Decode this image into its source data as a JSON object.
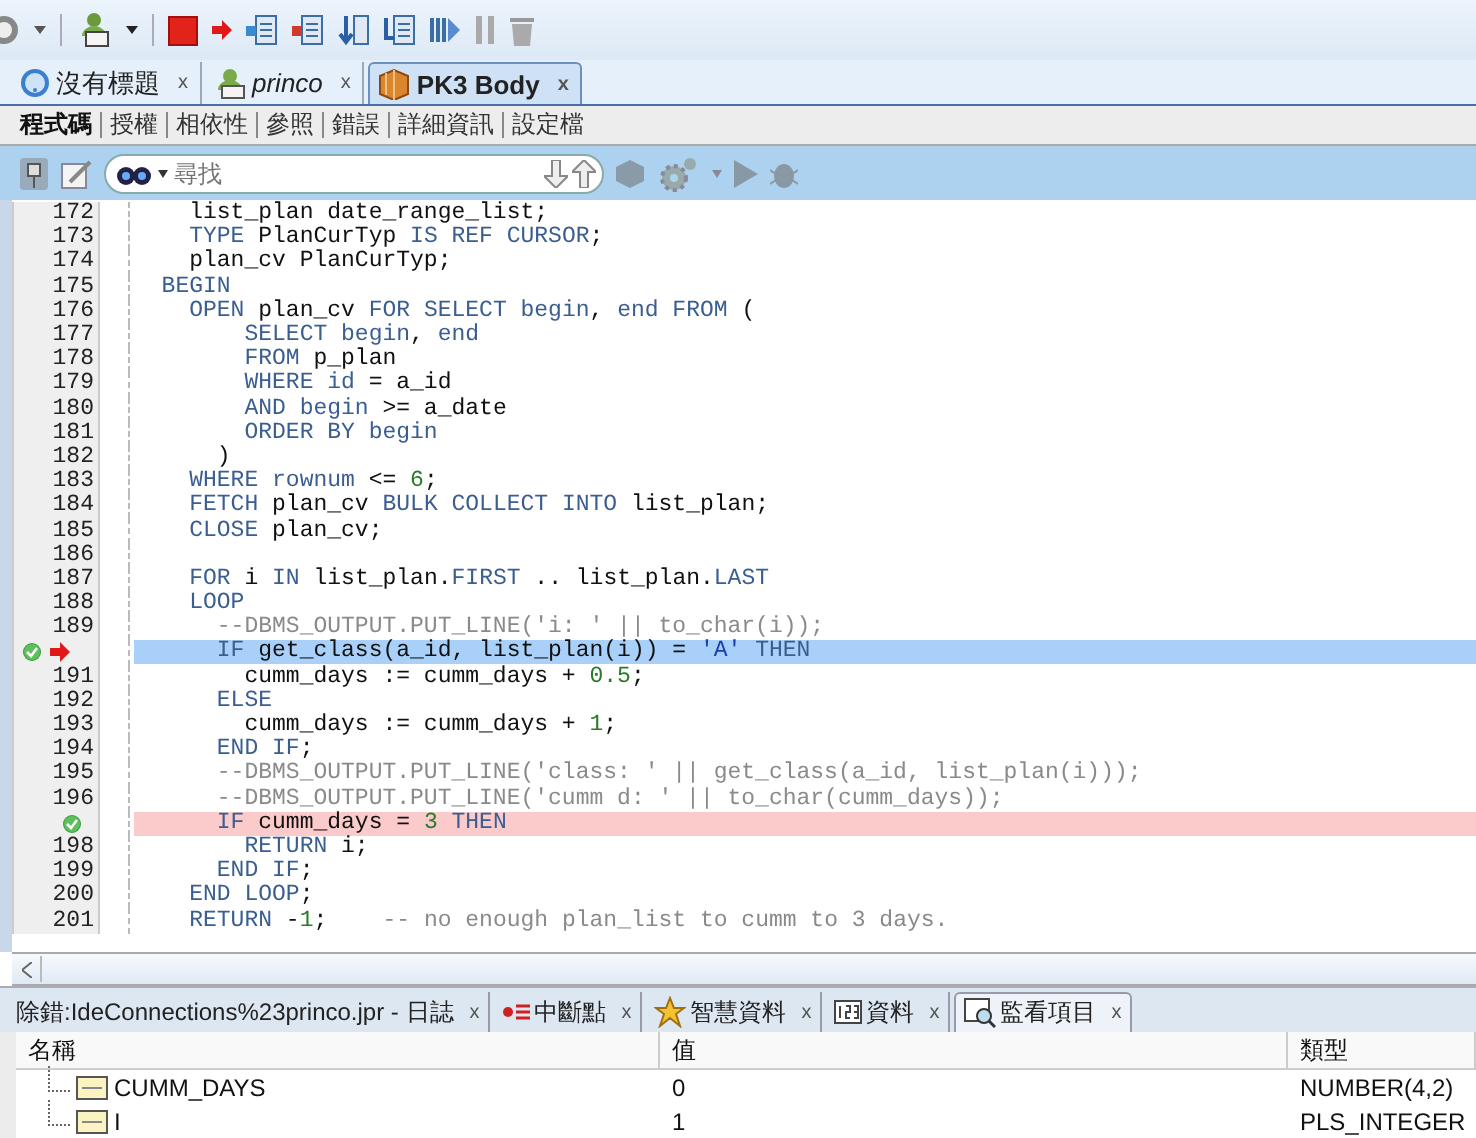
{
  "editor_tabs": [
    {
      "kind": "untitled",
      "label": "沒有標題",
      "close": "x",
      "selected": false
    },
    {
      "kind": "connection",
      "label": "princo",
      "close": "x",
      "selected": false
    },
    {
      "kind": "package",
      "label": "PK3 Body",
      "close": "x",
      "selected": true
    }
  ],
  "sub_tabs": [
    {
      "label": "程式碼",
      "selected": true
    },
    {
      "label": "授權",
      "selected": false
    },
    {
      "label": "相依性",
      "selected": false
    },
    {
      "label": "參照",
      "selected": false
    },
    {
      "label": "錯誤",
      "selected": false
    },
    {
      "label": "詳細資訊",
      "selected": false
    },
    {
      "label": "設定檔",
      "selected": false
    }
  ],
  "search": {
    "placeholder": "尋找"
  },
  "code_lines": [
    {
      "number": "172",
      "segments": [
        {
          "kind": "plain",
          "text": "    list_plan date_range_list;"
        }
      ]
    },
    {
      "number": "173",
      "segments": [
        {
          "kind": "keyword",
          "text": "    TYPE"
        },
        {
          "kind": "plain",
          "text": " PlanCurTyp "
        },
        {
          "kind": "keyword",
          "text": "IS REF CURSOR"
        },
        {
          "kind": "plain",
          "text": ";"
        }
      ]
    },
    {
      "number": "174",
      "segments": [
        {
          "kind": "plain",
          "text": "    plan_cv PlanCurTyp;"
        }
      ]
    },
    {
      "number": "175",
      "segments": [
        {
          "kind": "keyword",
          "text": "  BEGIN"
        }
      ]
    },
    {
      "number": "176",
      "segments": [
        {
          "kind": "keyword",
          "text": "    OPEN"
        },
        {
          "kind": "plain",
          "text": " plan_cv "
        },
        {
          "kind": "keyword",
          "text": "FOR SELECT begin"
        },
        {
          "kind": "plain",
          "text": ", "
        },
        {
          "kind": "keyword",
          "text": "end FROM"
        },
        {
          "kind": "plain",
          "text": " ("
        }
      ]
    },
    {
      "number": "177",
      "segments": [
        {
          "kind": "keyword",
          "text": "        SELECT begin"
        },
        {
          "kind": "plain",
          "text": ", "
        },
        {
          "kind": "keyword",
          "text": "end"
        }
      ]
    },
    {
      "number": "178",
      "segments": [
        {
          "kind": "keyword",
          "text": "        FROM"
        },
        {
          "kind": "plain",
          "text": " p_plan"
        }
      ]
    },
    {
      "number": "179",
      "segments": [
        {
          "kind": "keyword",
          "text": "        WHERE id"
        },
        {
          "kind": "plain",
          "text": " = a_id"
        }
      ]
    },
    {
      "number": "180",
      "segments": [
        {
          "kind": "keyword",
          "text": "        AND begin"
        },
        {
          "kind": "plain",
          "text": " >= a_date"
        }
      ]
    },
    {
      "number": "181",
      "segments": [
        {
          "kind": "keyword",
          "text": "        ORDER BY begin"
        }
      ]
    },
    {
      "number": "182",
      "segments": [
        {
          "kind": "plain",
          "text": "      )"
        }
      ]
    },
    {
      "number": "183",
      "segments": [
        {
          "kind": "keyword",
          "text": "    WHERE rownum"
        },
        {
          "kind": "plain",
          "text": " <= "
        },
        {
          "kind": "number",
          "text": "6"
        },
        {
          "kind": "plain",
          "text": ";"
        }
      ]
    },
    {
      "number": "184",
      "segments": [
        {
          "kind": "keyword",
          "text": "    FETCH"
        },
        {
          "kind": "plain",
          "text": " plan_cv "
        },
        {
          "kind": "keyword",
          "text": "BULK COLLECT INTO"
        },
        {
          "kind": "plain",
          "text": " list_plan;"
        }
      ]
    },
    {
      "number": "185",
      "segments": [
        {
          "kind": "keyword",
          "text": "    CLOSE"
        },
        {
          "kind": "plain",
          "text": " plan_cv;"
        }
      ]
    },
    {
      "number": "186"
    },
    {
      "number": "187",
      "segments": [
        {
          "kind": "keyword",
          "text": "    FOR"
        },
        {
          "kind": "plain",
          "text": " i "
        },
        {
          "kind": "keyword",
          "text": "IN"
        },
        {
          "kind": "plain",
          "text": " list_plan."
        },
        {
          "kind": "keyword",
          "text": "FIRST"
        },
        {
          "kind": "plain",
          "text": " .. list_plan."
        },
        {
          "kind": "keyword",
          "text": "LAST"
        }
      ]
    },
    {
      "number": "188",
      "segments": [
        {
          "kind": "keyword",
          "text": "    LOOP"
        }
      ]
    },
    {
      "number": "189",
      "segments": [
        {
          "kind": "comment",
          "text": "      --DBMS_OUTPUT.PUT_LINE('i: ' || to_char(i));"
        }
      ]
    },
    {
      "breakpoint": true,
      "current": true,
      "segments": [
        {
          "kind": "keyword",
          "text": "      IF"
        },
        {
          "kind": "plain",
          "text": " get_class(a_id, list_plan(i)) = "
        },
        {
          "kind": "string",
          "text": "'A'"
        },
        {
          "kind": "keyword",
          "text": " THEN"
        }
      ]
    },
    {
      "number": "191",
      "segments": [
        {
          "kind": "plain",
          "text": "        cumm_days := cumm_days + "
        },
        {
          "kind": "number",
          "text": "0.5"
        },
        {
          "kind": "plain",
          "text": ";"
        }
      ]
    },
    {
      "number": "192",
      "segments": [
        {
          "kind": "keyword",
          "text": "      ELSE"
        }
      ]
    },
    {
      "number": "193",
      "segments": [
        {
          "kind": "plain",
          "text": "        cumm_days := cumm_days + "
        },
        {
          "kind": "number",
          "text": "1"
        },
        {
          "kind": "plain",
          "text": ";"
        }
      ]
    },
    {
      "number": "194",
      "segments": [
        {
          "kind": "keyword",
          "text": "      END IF"
        },
        {
          "kind": "plain",
          "text": ";"
        }
      ]
    },
    {
      "number": "195",
      "segments": [
        {
          "kind": "comment",
          "text": "      --DBMS_OUTPUT.PUT_LINE('class: ' || get_class(a_id, list_plan(i)));"
        }
      ]
    },
    {
      "number": "196",
      "segments": [
        {
          "kind": "comment",
          "text": "      --DBMS_OUTPUT.PUT_LINE('cumm d: ' || to_char(cumm_days));"
        }
      ]
    },
    {
      "breakpoint": true,
      "current": false,
      "segments": [
        {
          "kind": "keyword",
          "text": "      IF"
        },
        {
          "kind": "plain",
          "text": " cumm_days = "
        },
        {
          "kind": "number",
          "text": "3"
        },
        {
          "kind": "keyword",
          "text": " THEN"
        }
      ]
    },
    {
      "number": "198",
      "segments": [
        {
          "kind": "keyword",
          "text": "        RETURN"
        },
        {
          "kind": "plain",
          "text": " i;"
        }
      ]
    },
    {
      "number": "199",
      "segments": [
        {
          "kind": "keyword",
          "text": "      END IF"
        },
        {
          "kind": "plain",
          "text": ";"
        }
      ]
    },
    {
      "number": "200",
      "segments": [
        {
          "kind": "keyword",
          "text": "    END LOOP"
        },
        {
          "kind": "plain",
          "text": ";"
        }
      ]
    },
    {
      "number": "201",
      "segments": [
        {
          "kind": "keyword",
          "text": "    RETURN"
        },
        {
          "kind": "plain",
          "text": " -"
        },
        {
          "kind": "number",
          "text": "1"
        },
        {
          "kind": "plain",
          "text": ";"
        },
        {
          "kind": "comment",
          "text": "    -- no enough plan_list to cumm to 3 days."
        }
      ]
    }
  ],
  "bottom_tabs": [
    {
      "kind": "log",
      "label": "除錯:IdeConnections%23princo.jpr - 日誌",
      "close": "x",
      "selected": false
    },
    {
      "kind": "breakpoints",
      "label": "中斷點",
      "close": "x",
      "selected": false
    },
    {
      "kind": "smart",
      "label": "智慧資料",
      "close": "x",
      "selected": false
    },
    {
      "kind": "data",
      "label": "資料",
      "close": "x",
      "selected": false
    },
    {
      "kind": "watches",
      "label": "監看項目",
      "close": "x",
      "selected": true
    }
  ],
  "watch": {
    "columns": [
      "名稱",
      "值",
      "類型"
    ],
    "rows": [
      {
        "name": "CUMM_DAYS",
        "value": "0",
        "type": "NUMBER(4,2)"
      },
      {
        "name": "I",
        "value": "1",
        "type": "PLS_INTEGER"
      }
    ]
  }
}
